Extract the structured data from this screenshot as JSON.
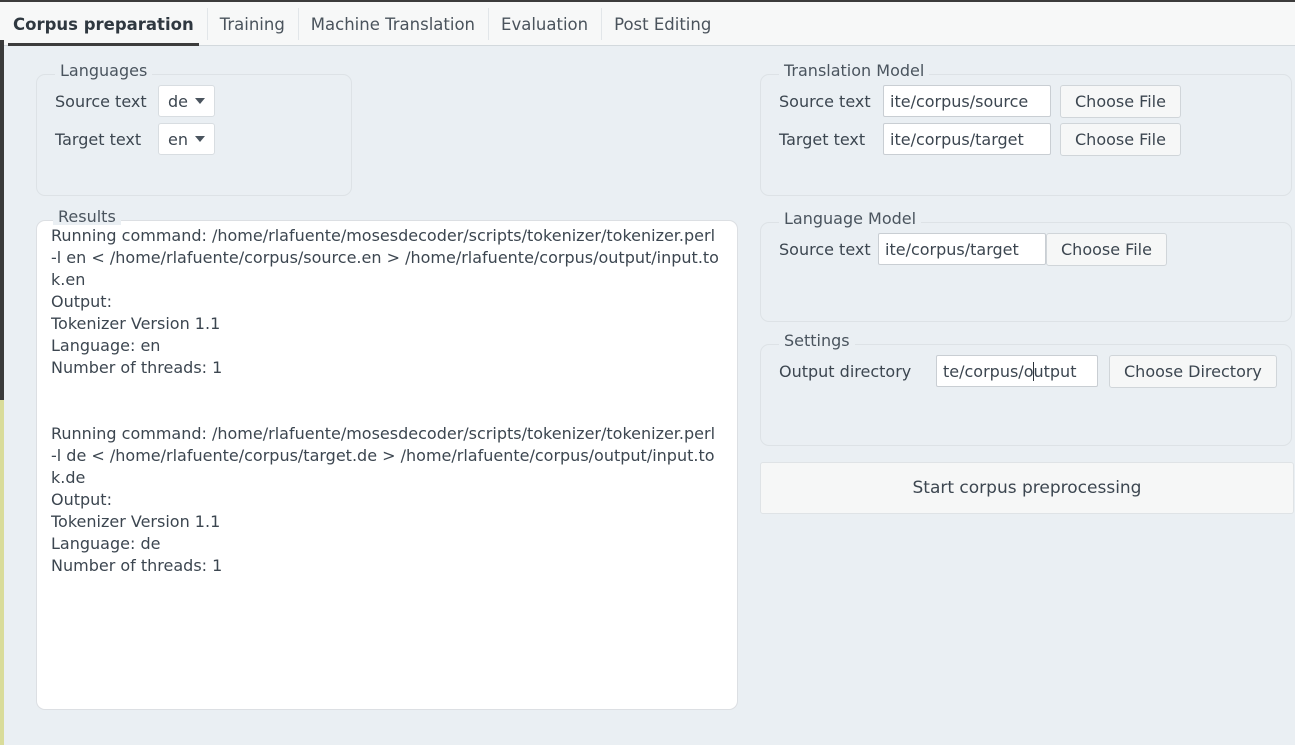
{
  "tabs": [
    {
      "label": "Corpus preparation",
      "active": true
    },
    {
      "label": "Training",
      "active": false
    },
    {
      "label": "Machine Translation",
      "active": false
    },
    {
      "label": "Evaluation",
      "active": false
    },
    {
      "label": "Post Editing",
      "active": false
    }
  ],
  "languages": {
    "legend": "Languages",
    "source_label": "Source text",
    "source_value": "de",
    "target_label": "Target text",
    "target_value": "en"
  },
  "results": {
    "legend": "Results",
    "text": "Running command: /home/rlafuente/mosesdecoder/scripts/tokenizer/tokenizer.perl  -l en < /home/rlafuente/corpus/source.en > /home/rlafuente/corpus/output/input.tok.en\nOutput:\nTokenizer Version 1.1\nLanguage: en\nNumber of threads: 1\n\n\nRunning command: /home/rlafuente/mosesdecoder/scripts/tokenizer/tokenizer.perl  -l de < /home/rlafuente/corpus/target.de > /home/rlafuente/corpus/output/input.tok.de\nOutput:\nTokenizer Version 1.1\nLanguage: de\nNumber of threads: 1"
  },
  "translation_model": {
    "legend": "Translation Model",
    "source_label": "Source text",
    "source_value": "ite/corpus/source",
    "source_button": "Choose File",
    "target_label": "Target text",
    "target_value": "ite/corpus/target",
    "target_button": "Choose File"
  },
  "language_model": {
    "legend": "Language Model",
    "source_label": "Source text",
    "source_value": "ite/corpus/target",
    "source_button": "Choose File"
  },
  "settings": {
    "legend": "Settings",
    "output_label": "Output directory",
    "output_value_before_caret": "te/corpus/o",
    "output_value_after_caret": "utput",
    "output_button": "Choose Directory"
  },
  "actions": {
    "start_label": "Start corpus preprocessing"
  },
  "colors": {
    "page_background": "#eaeff3",
    "tabbar_background": "#f7f8f8",
    "active_tab_underline": "#3c3c3c",
    "text": "#3c4650",
    "panel_border": "#dde2e6",
    "field_background": "#ffffff",
    "button_background": "#f6f7f7"
  }
}
